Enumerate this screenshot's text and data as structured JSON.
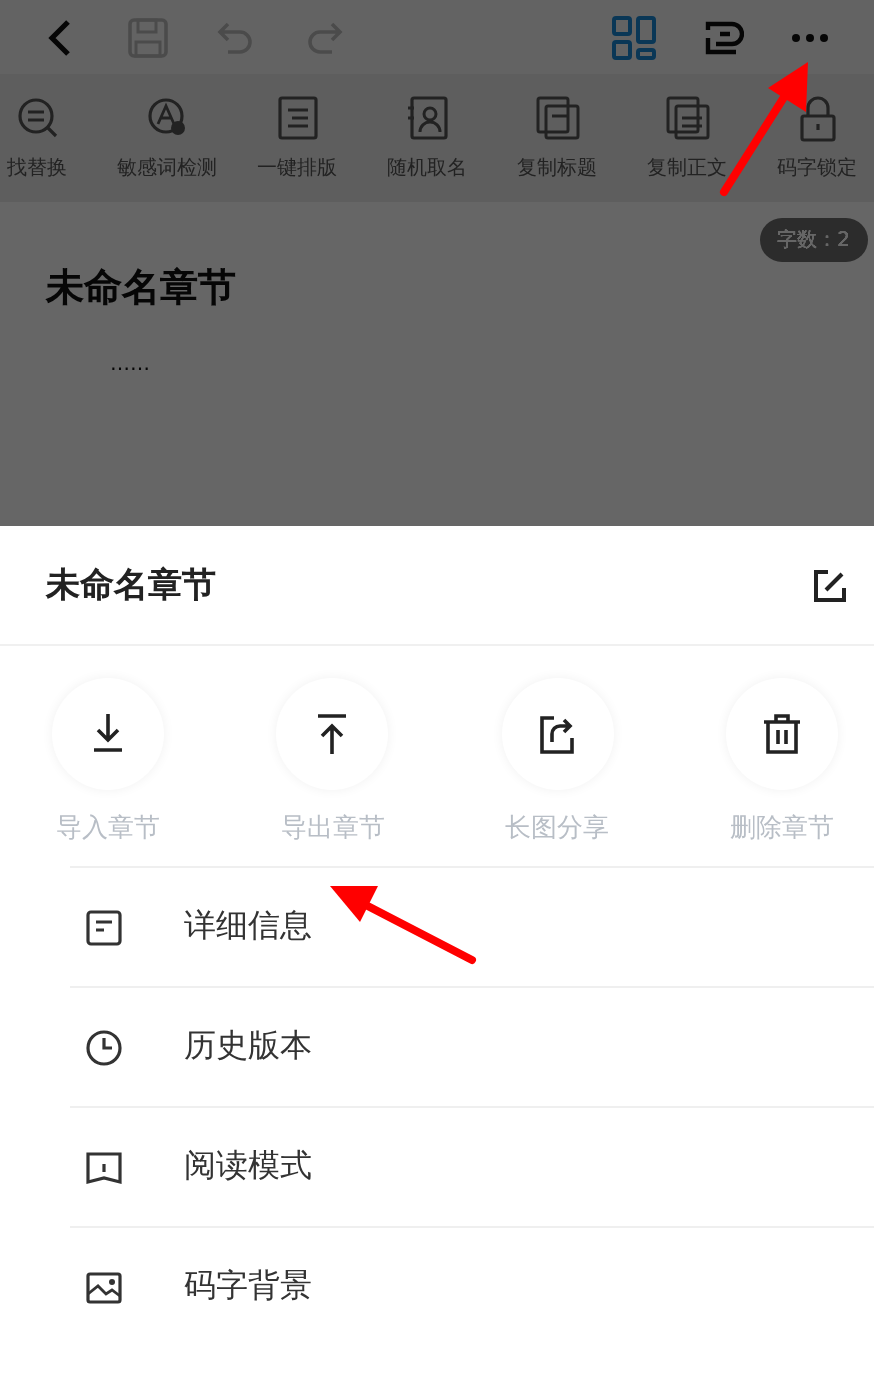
{
  "top_bar": {
    "buttons": [
      {
        "kind": "back",
        "disabled": false
      },
      {
        "kind": "save",
        "disabled": true
      },
      {
        "kind": "undo",
        "disabled": true
      },
      {
        "kind": "redo",
        "disabled": true
      },
      {
        "kind": "grid",
        "disabled": false
      },
      {
        "kind": "switch",
        "disabled": false
      },
      {
        "kind": "more",
        "disabled": false
      }
    ]
  },
  "tools": [
    {
      "kind": "replace",
      "label": "找替换"
    },
    {
      "kind": "check",
      "label": "敏感词检测"
    },
    {
      "kind": "format",
      "label": "一键排版"
    },
    {
      "kind": "name",
      "label": "随机取名"
    },
    {
      "kind": "copy-title",
      "label": "复制标题"
    },
    {
      "kind": "copy-text",
      "label": "复制正文"
    },
    {
      "kind": "lock",
      "label": "码字锁定"
    }
  ],
  "editor": {
    "word_count": "字数：2",
    "title": "未命名章节",
    "body": "……"
  },
  "sheet": {
    "title": "未命名章节",
    "actions": [
      {
        "kind": "import",
        "label": "导入章节"
      },
      {
        "kind": "export",
        "label": "导出章节"
      },
      {
        "kind": "share",
        "label": "长图分享"
      },
      {
        "kind": "delete",
        "label": "删除章节"
      }
    ],
    "items": [
      {
        "kind": "info",
        "label": "详细信息"
      },
      {
        "kind": "history",
        "label": "历史版本"
      },
      {
        "kind": "read",
        "label": "阅读模式"
      },
      {
        "kind": "background",
        "label": "码字背景"
      }
    ]
  }
}
